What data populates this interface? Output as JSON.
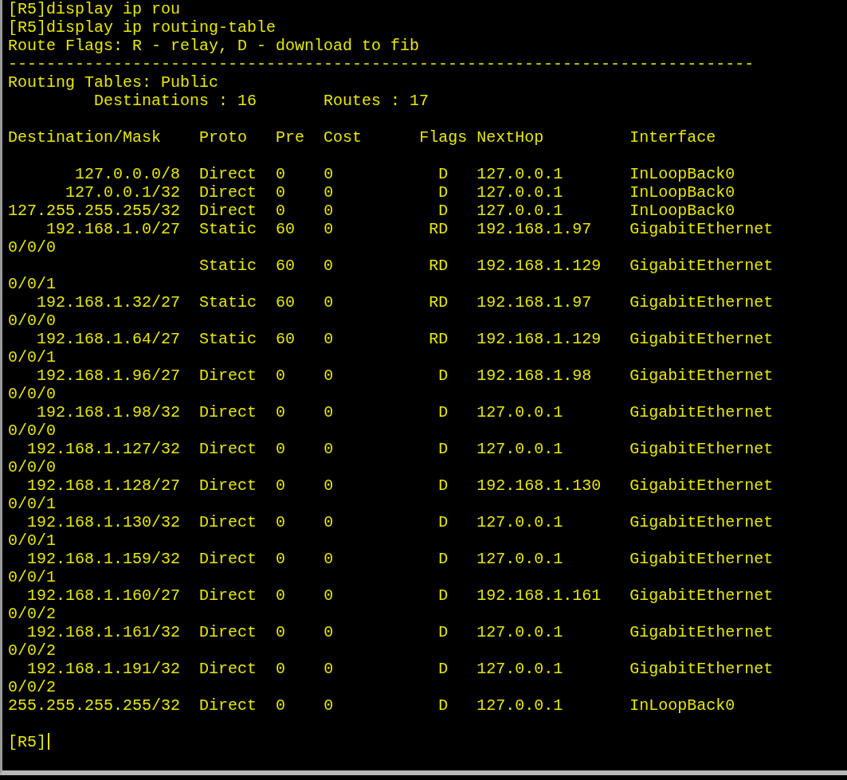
{
  "terminal": {
    "lines_before": [
      "[R5]display ip rou",
      "[R5]display ip routing-table",
      "Route Flags: R - relay, D - download to fib"
    ],
    "divider": "------------------------------------------------------------------------------",
    "table_title": "Routing Tables: Public",
    "summary": [
      "Destinations : 16",
      "Routes : 17"
    ],
    "columns": [
      "Destination/Mask",
      "Proto",
      "Pre",
      "Cost",
      "Flags",
      "NextHop",
      "Interface"
    ],
    "rows": [
      {
        "destination": "127.0.0.0/8",
        "proto": "Direct",
        "pre": "0",
        "cost": "0",
        "flags": "D",
        "nexthop": "127.0.0.1",
        "interface": "InLoopBack0"
      },
      {
        "destination": "127.0.0.1/32",
        "proto": "Direct",
        "pre": "0",
        "cost": "0",
        "flags": "D",
        "nexthop": "127.0.0.1",
        "interface": "InLoopBack0"
      },
      {
        "destination": "127.255.255.255/32",
        "proto": "Direct",
        "pre": "0",
        "cost": "0",
        "flags": "D",
        "nexthop": "127.0.0.1",
        "interface": "InLoopBack0"
      },
      {
        "destination": "192.168.1.0/27",
        "proto": "Static",
        "pre": "60",
        "cost": "0",
        "flags": "RD",
        "nexthop": "192.168.1.97",
        "interface": "GigabitEthernet",
        "interface_wrapped": "0/0/0"
      },
      {
        "proto": "Static",
        "pre": "60",
        "cost": "0",
        "flags": "RD",
        "nexthop": "192.168.1.129",
        "interface": "GigabitEthernet",
        "interface_wrapped": "0/0/1"
      },
      {
        "destination": "192.168.1.32/27",
        "proto": "Static",
        "pre": "60",
        "cost": "0",
        "flags": "RD",
        "nexthop": "192.168.1.97",
        "interface": "GigabitEthernet",
        "interface_wrapped": "0/0/0"
      },
      {
        "destination": "192.168.1.64/27",
        "proto": "Static",
        "pre": "60",
        "cost": "0",
        "flags": "RD",
        "nexthop": "192.168.1.129",
        "interface": "GigabitEthernet",
        "interface_wrapped": "0/0/1"
      },
      {
        "destination": "192.168.1.96/27",
        "proto": "Direct",
        "pre": "0",
        "cost": "0",
        "flags": "D",
        "nexthop": "192.168.1.98",
        "interface": "GigabitEthernet",
        "interface_wrapped": "0/0/0"
      },
      {
        "destination": "192.168.1.98/32",
        "proto": "Direct",
        "pre": "0",
        "cost": "0",
        "flags": "D",
        "nexthop": "127.0.0.1",
        "interface": "GigabitEthernet",
        "interface_wrapped": "0/0/0"
      },
      {
        "destination": "192.168.1.127/32",
        "proto": "Direct",
        "pre": "0",
        "cost": "0",
        "flags": "D",
        "nexthop": "127.0.0.1",
        "interface": "GigabitEthernet",
        "interface_wrapped": "0/0/0"
      },
      {
        "destination": "192.168.1.128/27",
        "proto": "Direct",
        "pre": "0",
        "cost": "0",
        "flags": "D",
        "nexthop": "192.168.1.130",
        "interface": "GigabitEthernet",
        "interface_wrapped": "0/0/1"
      },
      {
        "destination": "192.168.1.130/32",
        "proto": "Direct",
        "pre": "0",
        "cost": "0",
        "flags": "D",
        "nexthop": "127.0.0.1",
        "interface": "GigabitEthernet",
        "interface_wrapped": "0/0/1"
      },
      {
        "destination": "192.168.1.159/32",
        "proto": "Direct",
        "pre": "0",
        "cost": "0",
        "flags": "D",
        "nexthop": "127.0.0.1",
        "interface": "GigabitEthernet",
        "interface_wrapped": "0/0/1"
      },
      {
        "destination": "192.168.1.160/27",
        "proto": "Direct",
        "pre": "0",
        "cost": "0",
        "flags": "D",
        "nexthop": "192.168.1.161",
        "interface": "GigabitEthernet",
        "interface_wrapped": "0/0/2"
      },
      {
        "destination": "192.168.1.161/32",
        "proto": "Direct",
        "pre": "0",
        "cost": "0",
        "flags": "D",
        "nexthop": "127.0.0.1",
        "interface": "GigabitEthernet",
        "interface_wrapped": "0/0/2"
      },
      {
        "destination": "192.168.1.191/32",
        "proto": "Direct",
        "pre": "0",
        "cost": "0",
        "flags": "D",
        "nexthop": "127.0.0.1",
        "interface": "GigabitEthernet",
        "interface_wrapped": "0/0/2"
      },
      {
        "destination": "255.255.255.255/32",
        "proto": "Direct",
        "pre": "0",
        "cost": "0",
        "flags": "D",
        "nexthop": "127.0.0.1",
        "interface": "InLoopBack0"
      }
    ],
    "prompt": "[R5]"
  }
}
